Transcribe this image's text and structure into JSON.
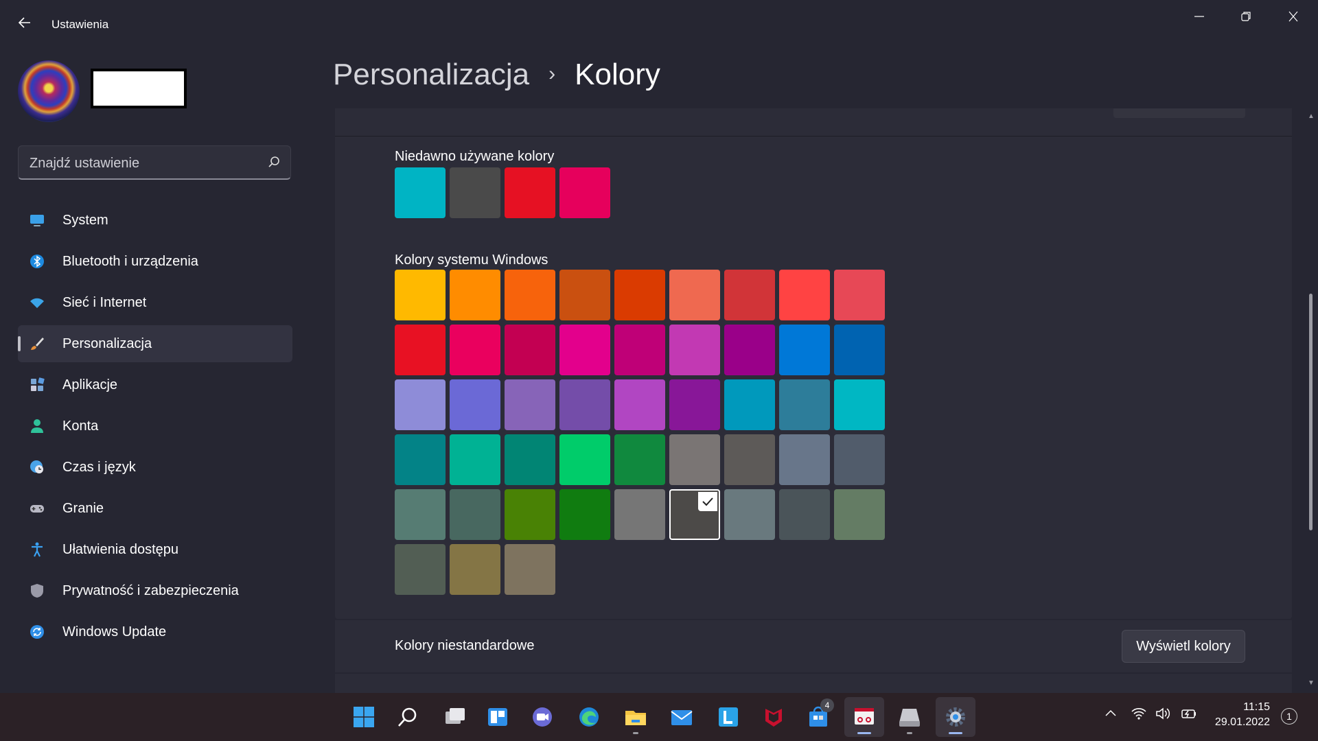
{
  "app": {
    "title": "Ustawienia"
  },
  "user": {
    "avatar_icon": "avatar-image"
  },
  "search": {
    "placeholder": "Znajdź ustawienie"
  },
  "nav": [
    {
      "label": "System",
      "icon": "system-monitor-icon",
      "color": "#3aa0e8"
    },
    {
      "label": "Bluetooth i urządzenia",
      "icon": "bluetooth-icon",
      "color": "#1e8ae0"
    },
    {
      "label": "Sieć i Internet",
      "icon": "wifi-icon",
      "color": "#3ba4e8"
    },
    {
      "label": "Personalizacja",
      "icon": "brush-icon",
      "color": "#e8903a",
      "selected": true
    },
    {
      "label": "Aplikacje",
      "icon": "apps-icon",
      "color": "#7aa6d6"
    },
    {
      "label": "Konta",
      "icon": "account-icon",
      "color": "#2fc29a"
    },
    {
      "label": "Czas i język",
      "icon": "globe-clock-icon",
      "color": "#4aa3e8"
    },
    {
      "label": "Granie",
      "icon": "gamepad-icon",
      "color": "#b8b8c4"
    },
    {
      "label": "Ułatwienia dostępu",
      "icon": "accessibility-icon",
      "color": "#3aa0f0"
    },
    {
      "label": "Prywatność i zabezpieczenia",
      "icon": "shield-icon",
      "color": "#9a9aa8"
    },
    {
      "label": "Windows Update",
      "icon": "update-icon",
      "color": "#2f8fe8"
    }
  ],
  "breadcrumb": {
    "parent": "Personalizacja",
    "separator": "›",
    "current": "Kolory"
  },
  "recent": {
    "title": "Niedawno używane kolory",
    "colors": [
      "#00B4C4",
      "#4A4A4A",
      "#E61123",
      "#E6005C"
    ]
  },
  "windows_colors": {
    "title": "Kolory systemu Windows",
    "selected_index": 41,
    "colors": [
      "#FFB900",
      "#FF8C00",
      "#F7630C",
      "#CA5010",
      "#DA3B01",
      "#EF6950",
      "#D13438",
      "#FF4343",
      "#E74856",
      "#E81123",
      "#EA005E",
      "#C30052",
      "#E3008C",
      "#BF0077",
      "#C239B3",
      "#9A0089",
      "#0078D7",
      "#0063B1",
      "#8E8CD8",
      "#6B69D6",
      "#8764B8",
      "#744DA9",
      "#B146C2",
      "#881798",
      "#0099BC",
      "#2D7D9A",
      "#00B7C3",
      "#038387",
      "#00B294",
      "#018574",
      "#00CC6A",
      "#10893E",
      "#7A7574",
      "#5D5A58",
      "#68768A",
      "#515C6B",
      "#567C73",
      "#486860",
      "#498205",
      "#107C10",
      "#767676",
      "#4C4A48",
      "#69797E",
      "#4A5459",
      "#647C64",
      "#525E54",
      "#847545",
      "#7E735F"
    ]
  },
  "custom": {
    "label": "Kolory niestandardowe",
    "button": "Wyświetl kolory"
  },
  "taskbar": {
    "apps": [
      {
        "name": "start-icon"
      },
      {
        "name": "search-icon"
      },
      {
        "name": "task-view-icon"
      },
      {
        "name": "widgets-icon"
      },
      {
        "name": "chat-icon"
      },
      {
        "name": "edge-icon"
      },
      {
        "name": "file-explorer-icon"
      },
      {
        "name": "mail-icon"
      },
      {
        "name": "l-app-icon"
      },
      {
        "name": "mcafee-icon"
      },
      {
        "name": "store-icon",
        "badge": "4"
      },
      {
        "name": "snipping-tool-icon"
      },
      {
        "name": "drive-icon"
      },
      {
        "name": "settings-icon"
      }
    ],
    "time": "11:15",
    "date": "29.01.2022",
    "notifications": "1"
  }
}
